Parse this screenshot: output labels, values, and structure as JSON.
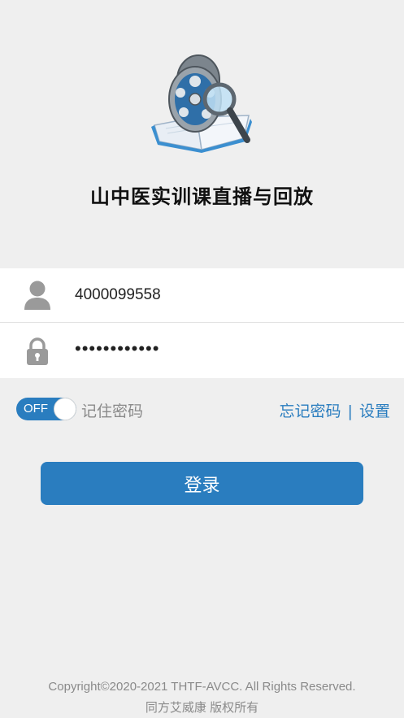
{
  "app": {
    "title": "山中医实训课直播与回放",
    "logo_icon": "film-reel-magnifier-book-icon"
  },
  "login_form": {
    "username": {
      "icon": "user-icon",
      "value": "4000099558"
    },
    "password": {
      "icon": "lock-icon",
      "masked_value": "••••••••••••"
    }
  },
  "options": {
    "remember_toggle": {
      "state_label": "OFF",
      "on": false
    },
    "remember_label": "记住密码",
    "forgot_password_link": "忘记密码",
    "separator": "|",
    "settings_link": "设置"
  },
  "login_button": {
    "label": "登录"
  },
  "footer": {
    "copyright": "Copyright©2020-2021 THTF-AVCC. All Rights Reserved.",
    "company": "同方艾威康 版权所有"
  },
  "colors": {
    "accent": "#2a7dbf",
    "background": "#efefef",
    "muted_text": "#8a8a8a"
  }
}
